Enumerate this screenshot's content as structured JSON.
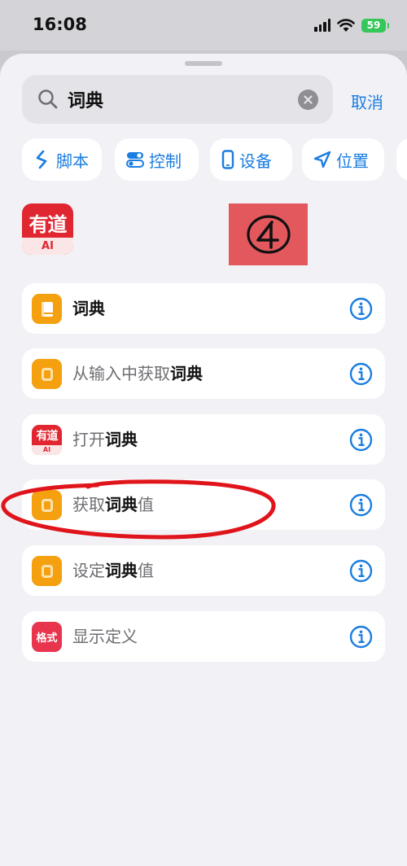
{
  "status_bar": {
    "time": "16:08",
    "battery": "59"
  },
  "search": {
    "query": "词典",
    "cancel_label": "取消"
  },
  "categories": [
    {
      "label": "脚本",
      "icon": "script-icon"
    },
    {
      "label": "控制",
      "icon": "toggle-icon"
    },
    {
      "label": "设备",
      "icon": "phone-icon"
    },
    {
      "label": "位置",
      "icon": "location-arrow-icon"
    }
  ],
  "app_logo": {
    "name": "youdao-ai-logo",
    "text_top": "有道",
    "text_bottom": "AI"
  },
  "annotation": {
    "label": "④",
    "color": "#e3585d"
  },
  "results": [
    {
      "parts": [
        {
          "text": "词典",
          "bold": true
        }
      ],
      "icon": "book-icon"
    },
    {
      "parts": [
        {
          "text": "从输入中获取",
          "bold": false
        },
        {
          "text": "词典",
          "bold": true
        }
      ],
      "icon": "dictionary-icon"
    },
    {
      "parts": [
        {
          "text": "打开",
          "bold": false
        },
        {
          "text": "词典",
          "bold": true
        }
      ],
      "icon": "youdao-app-icon"
    },
    {
      "parts": [
        {
          "text": "获取",
          "bold": false
        },
        {
          "text": "词典",
          "bold": true
        },
        {
          "text": "值",
          "bold": false
        }
      ],
      "icon": "dictionary-icon"
    },
    {
      "parts": [
        {
          "text": "设定",
          "bold": false
        },
        {
          "text": "词典",
          "bold": true
        },
        {
          "text": "值",
          "bold": false
        }
      ],
      "icon": "dictionary-icon"
    },
    {
      "parts": [
        {
          "text": "显示定义",
          "bold": false
        }
      ],
      "icon": "format-icon",
      "icon_text": "格式"
    }
  ],
  "colors": {
    "accent": "#1a7de0",
    "dictionary_orange": "#f5a00e",
    "format_red": "#e8344c",
    "youdao_red": "#e02630",
    "highlight_ellipse": "#e0141b"
  }
}
